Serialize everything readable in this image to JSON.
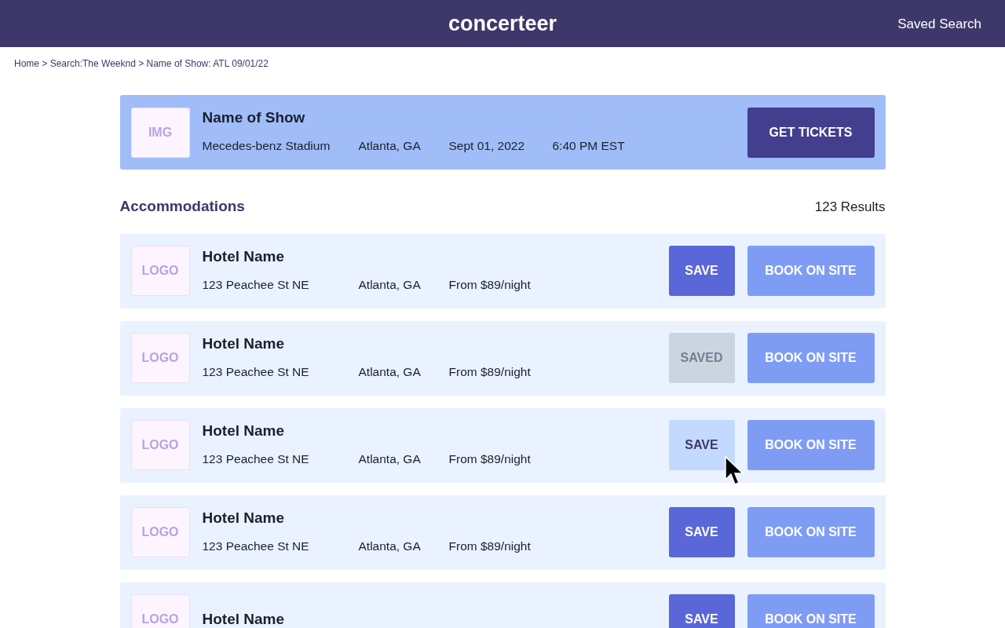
{
  "header": {
    "logo": "concerteer",
    "link": "Saved Search"
  },
  "breadcrumb": "Home > Search:The Weeknd > Name of Show: ATL 09/01/22",
  "show": {
    "image_label": "IMG",
    "name": "Name of Show",
    "details": [
      "Mecedes-benz Stadium",
      "Atlanta, GA",
      "Sept 01, 2022",
      "6:40 PM EST"
    ],
    "button": "GET TICKETS"
  },
  "section": {
    "title": "Accommodations",
    "count": "123 Results"
  },
  "hotels": [
    {
      "logo_label": "LOGO",
      "name": "Hotel Name",
      "details": [
        "123 Peachee St NE",
        "Atlanta, GA",
        "From $89/night"
      ],
      "save": {
        "label": "SAVE",
        "saved": false,
        "hovered": false
      },
      "book": "BOOK ON SITE"
    },
    {
      "logo_label": "LOGO",
      "name": "Hotel Name",
      "details": [
        "123 Peachee St NE",
        "Atlanta, GA",
        "From $89/night"
      ],
      "save": {
        "label": "SAVED",
        "saved": true,
        "hovered": false
      },
      "book": "BOOK ON SITE"
    },
    {
      "logo_label": "LOGO",
      "name": "Hotel Name",
      "details": [
        "123 Peachee St NE",
        "Atlanta, GA",
        "From $89/night"
      ],
      "save": {
        "label": "SAVE",
        "saved": false,
        "hovered": true
      },
      "book": "BOOK ON SITE"
    },
    {
      "logo_label": "LOGO",
      "name": "Hotel Name",
      "details": [
        "123 Peachee St NE",
        "Atlanta, GA",
        "From $89/night"
      ],
      "save": {
        "label": "SAVE",
        "saved": false,
        "hovered": false
      },
      "book": "BOOK ON SITE"
    },
    {
      "logo_label": "LOGO",
      "name": "Hotel Name",
      "save": {
        "label": "SAVE",
        "saved": false,
        "hovered": false
      },
      "book": "BOOK ON SITE"
    }
  ]
}
